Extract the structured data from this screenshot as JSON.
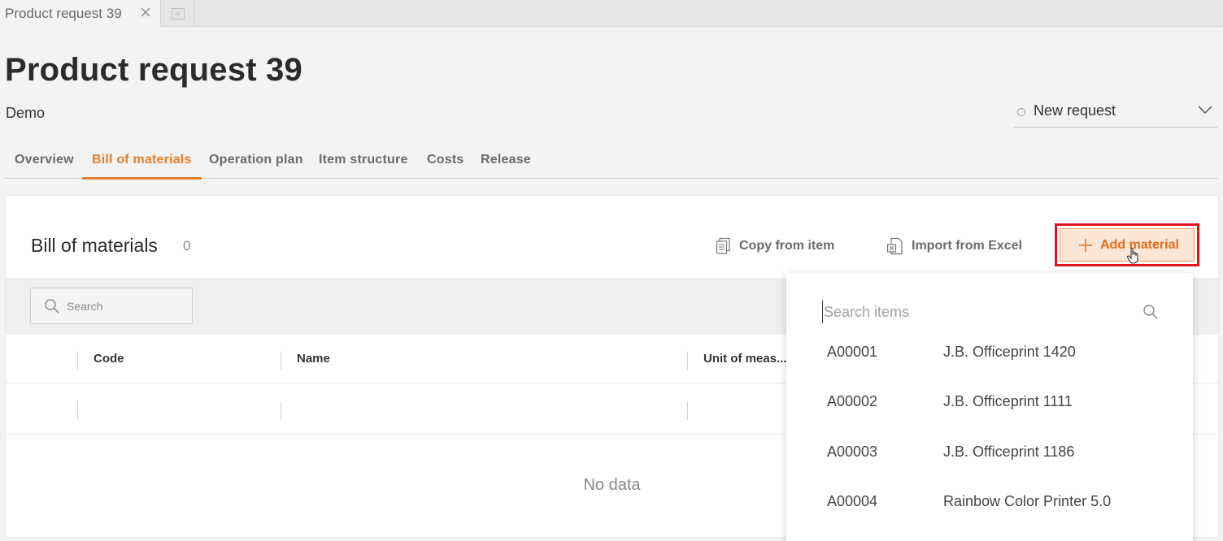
{
  "tabstrip": {
    "tab_label": "Product request 39"
  },
  "header": {
    "title": "Product request 39",
    "subtitle": "Demo",
    "status": "New request"
  },
  "nav": {
    "tabs": [
      {
        "label": "Overview"
      },
      {
        "label": "Bill of materials"
      },
      {
        "label": "Operation plan"
      },
      {
        "label": "Item structure"
      },
      {
        "label": "Costs"
      },
      {
        "label": "Release"
      }
    ],
    "active": "Bill of materials"
  },
  "panel": {
    "title": "Bill of materials",
    "count": "0",
    "copy_label": "Copy from item",
    "import_label": "Import from Excel",
    "add_label": "Add material",
    "search_placeholder": "Search",
    "columns": [
      "Code",
      "Name",
      "Unit of meas..."
    ],
    "empty_text": "No data"
  },
  "popover": {
    "search_placeholder": "Search items",
    "items": [
      {
        "code": "A00001",
        "name": "J.B. Officeprint 1420"
      },
      {
        "code": "A00002",
        "name": "J.B. Officeprint 1111"
      },
      {
        "code": "A00003",
        "name": "J.B. Officeprint 1186"
      },
      {
        "code": "A00004",
        "name": "Rainbow Color Printer 5.0"
      }
    ]
  },
  "colors": {
    "accent": "#e67e2b",
    "highlight": "#e0141e"
  }
}
